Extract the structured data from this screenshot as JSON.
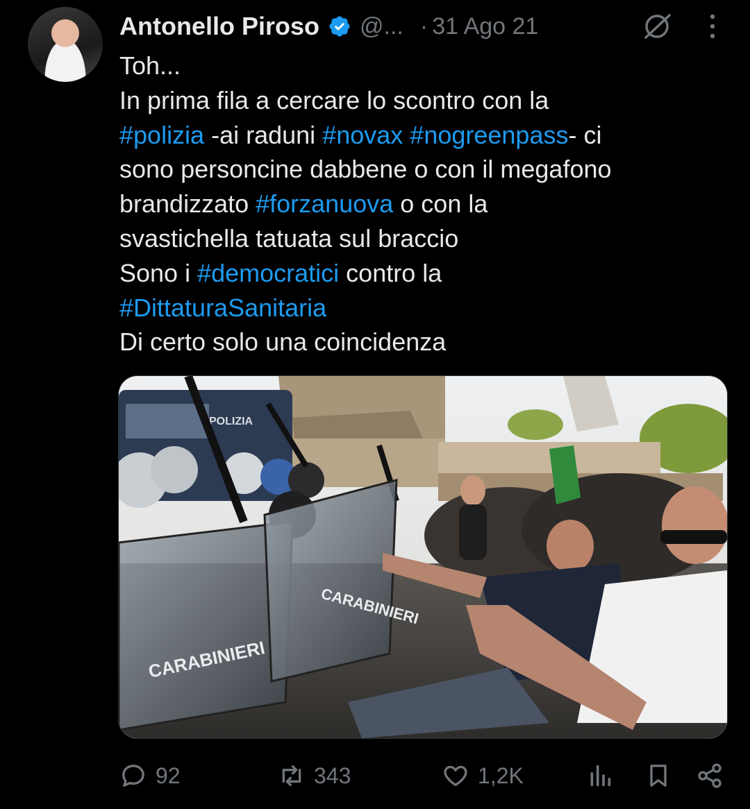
{
  "tweet": {
    "author_name": "Antonello Piroso",
    "handle": "@...",
    "separator": "·",
    "date": "31 Ago 21",
    "text_segments": [
      {
        "t": "Toh...\nIn prima fila a cercare lo scontro con la\n",
        "tag": false
      },
      {
        "t": "#polizia",
        "tag": true
      },
      {
        "t": " -ai raduni ",
        "tag": false
      },
      {
        "t": "#novax",
        "tag": true
      },
      {
        "t": " ",
        "tag": false
      },
      {
        "t": "#nogreenpass",
        "tag": true
      },
      {
        "t": "- ci\nsono personcine dabbene o con il megafono\nbrandizzato ",
        "tag": false
      },
      {
        "t": "#forzanuova",
        "tag": true
      },
      {
        "t": " o con la\nsvastichella tatuata sul braccio\nSono i ",
        "tag": false
      },
      {
        "t": "#democratici",
        "tag": true
      },
      {
        "t": " contro la\n",
        "tag": false
      },
      {
        "t": "#DittaturaSanitaria",
        "tag": true
      },
      {
        "t": "\nDi certo solo una coincidenza",
        "tag": false
      }
    ],
    "media": {
      "photo_shield_text_1": "CARABINIERI",
      "photo_shield_text_2": "CARABINIERI",
      "photo_van_text": "POLIZIA"
    },
    "actions": {
      "replies": "92",
      "retweets": "343",
      "likes": "1,2K"
    }
  },
  "icons": {
    "verified": "verified-badge-icon",
    "grok": "grok-icon",
    "more": "more-options-icon",
    "reply": "reply-icon",
    "retweet": "retweet-icon",
    "like": "heart-icon",
    "views": "views-icon",
    "bookmark": "bookmark-icon",
    "share": "share-icon"
  },
  "colors": {
    "background": "#000000",
    "text": "#e7e9ea",
    "secondary": "#71767b",
    "link": "#1d9bf0"
  }
}
